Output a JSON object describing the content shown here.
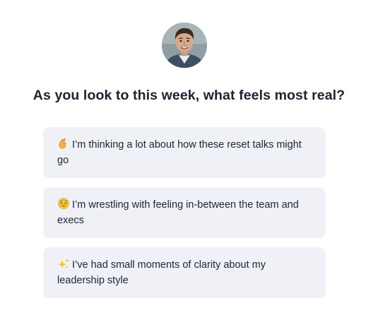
{
  "question": {
    "title": "As you look to this week, what feels most real?"
  },
  "avatar": {
    "description_icon": "profile-photo"
  },
  "options": [
    {
      "emoji_icon": "crossed-fingers-icon",
      "label": "I’m thinking a lot about how these reset talks might go"
    },
    {
      "emoji_icon": "relieved-face-icon",
      "label": "I’m wrestling with feeling in-between the team and execs"
    },
    {
      "emoji_icon": "sparkles-icon",
      "label": "I’ve had small moments of clarity about my leadership style"
    }
  ],
  "colors": {
    "option_background": "#eff1f6",
    "text": "#1f2433"
  }
}
